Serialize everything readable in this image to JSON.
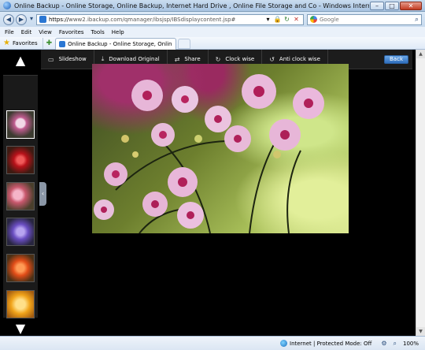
{
  "window": {
    "title": "Online Backup - Online Storage, Online Backup, Internet Hard Drive , Online File Storage and Co - Windows Internet Explorer",
    "minimize": "–",
    "maximize": "□",
    "close": "✕"
  },
  "address": {
    "url_scheme": "https://",
    "url_rest": "www2.ibackup.com/qmanager/ibsjsp/IBSdisplaycontent.jsp#",
    "search_placeholder": "Google"
  },
  "menu": [
    "File",
    "Edit",
    "View",
    "Favorites",
    "Tools",
    "Help"
  ],
  "favorites": {
    "label": "Favorites",
    "tab_title": "Online Backup - Online Storage, Online Backup, I..."
  },
  "toolbar": {
    "slideshow": "Slideshow",
    "download": "Download Original",
    "share": "Share",
    "clockwise": "Clock wise",
    "anticlockwise": "Anti clock wise",
    "back": "Back"
  },
  "thumbnails": [
    {
      "name": "thumb-orchid",
      "selected": true
    },
    {
      "name": "thumb-red-flower",
      "selected": false
    },
    {
      "name": "thumb-pink-flowers",
      "selected": false
    },
    {
      "name": "thumb-purple-flowers",
      "selected": false
    },
    {
      "name": "thumb-orange-flower",
      "selected": false
    },
    {
      "name": "thumb-yellow-flower",
      "selected": false
    }
  ],
  "status": {
    "zone": "Internet | Protected Mode: Off",
    "zoom": "100%"
  },
  "icons": {
    "up": "up-arrow-icon",
    "down": "down-arrow-icon",
    "collapse": "collapse-left-icon"
  },
  "colors": {
    "content_bg": "#000000",
    "back_button": "#2f6fbd"
  }
}
